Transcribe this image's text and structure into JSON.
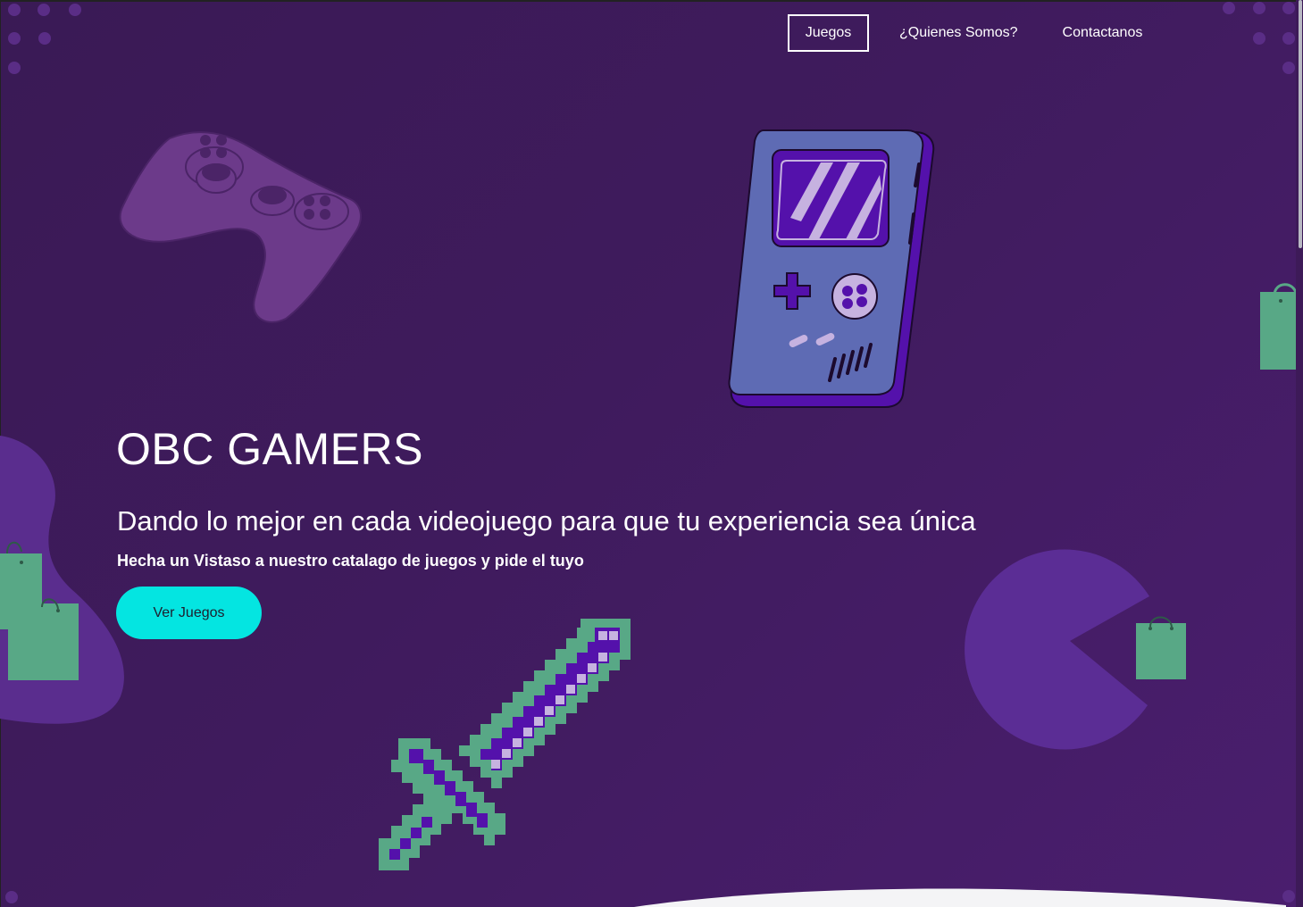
{
  "nav": {
    "items": [
      {
        "label": "Juegos",
        "active": true
      },
      {
        "label": "¿Quienes Somos?",
        "active": false
      },
      {
        "label": "Contactanos",
        "active": false
      }
    ]
  },
  "hero": {
    "title": "OBC GAMERS",
    "subtitle": "Dando lo mejor en cada videojuego para que tu experiencia sea única",
    "note": "Hecha un Vistaso a nuestro catalago de juegos y pide el tuyo",
    "cta_label": "Ver Juegos"
  },
  "icons": [
    "gamepad-icon",
    "gameboy-icon",
    "pixel-sword-icon",
    "pacman-icon",
    "shopping-bag-icon"
  ],
  "colors": {
    "background": "#3f1b5d",
    "accent": "#04e5e1",
    "bag_green": "#58a886",
    "blob_purple": "#5a2d8e"
  }
}
